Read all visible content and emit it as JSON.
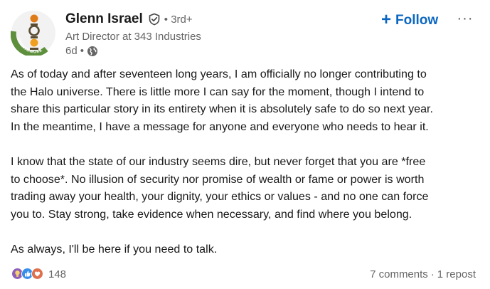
{
  "author": {
    "name": "Glenn Israel",
    "degree": "• 3rd+",
    "headline": "Art Director at 343 Industries",
    "time": "6d",
    "meta_separator": "•",
    "avatar_badge_text": "OPENTOWORK"
  },
  "actions": {
    "follow_icon": "+",
    "follow_label": "Follow",
    "more_label": "···"
  },
  "post": {
    "paragraph1": [
      "As of today and after seventeen long years, I am officially no longer contributing to",
      "the Halo universe. There is little more I can say for the moment, though I intend to",
      "share this particular story in its entirety when it is absolutely safe to do so next year.",
      "In the meantime, I have a message for anyone and everyone who needs to hear it."
    ],
    "paragraph2": [
      "I know that the state of our industry seems dire, but never forget that you are *free",
      "to choose*. No illusion of security nor promise of wealth or fame or power is worth",
      "trading away your health, your dignity, your ethics or values - and no one can force",
      "you to. Stay strong, take evidence when necessary, and find where you belong."
    ],
    "paragraph3": [
      "As always, I'll be here if you need to talk."
    ]
  },
  "social": {
    "reaction_icons": [
      "insightful-icon",
      "like-icon",
      "love-icon"
    ],
    "reaction_count": "148",
    "comments": "7 comments",
    "separator": "·",
    "reposts": "1 repost"
  },
  "colors": {
    "accent": "#0a66c2",
    "opentowork_green": "#5d8f3c",
    "muted_text": "#666666",
    "body_text": "#191919"
  }
}
